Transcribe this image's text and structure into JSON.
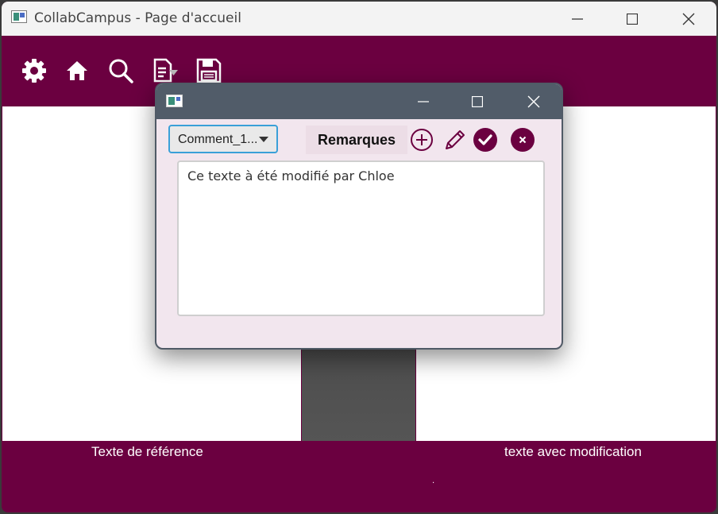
{
  "window": {
    "title": "CollabCampus - Page d'accueil",
    "controls": [
      "minimize-icon",
      "maximize-icon",
      "close-icon"
    ]
  },
  "toolbar": {
    "icons": [
      "gear-icon",
      "home-icon",
      "search-icon",
      "document-export-icon",
      "save-icon"
    ]
  },
  "labels": {
    "reference": "Texte de référence",
    "modified": "texte avec modification",
    "dot": "."
  },
  "dialog": {
    "comment_selector": {
      "selected": "Comment_1..."
    },
    "remarques_label": "Remarques",
    "actions": [
      "add-icon",
      "edit-pencil-icon",
      "confirm-check-icon",
      "delete-x-icon"
    ],
    "text_content": "Ce texte à été modifié par Chloe"
  },
  "colors": {
    "brand": "#6b0040",
    "dialog_bg": "#f2e6ee",
    "dialog_titlebar": "#515c69",
    "focus": "#3aa0d8"
  }
}
